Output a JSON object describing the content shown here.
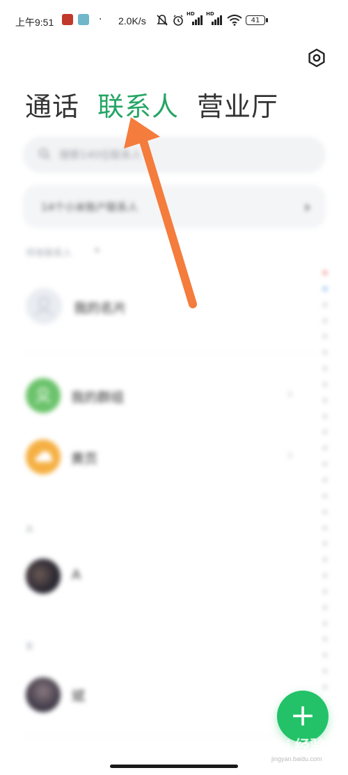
{
  "status_bar": {
    "time": "上午9:51",
    "network_speed": "2.0K/s",
    "hd_label_1": "HD",
    "hd_label_2": "HD",
    "battery": "41"
  },
  "tabs": [
    {
      "label": "通话",
      "active": false
    },
    {
      "label": "联系人",
      "active": true
    },
    {
      "label": "营业厅",
      "active": false
    }
  ],
  "search": {
    "placeholder": "搜索140位联系人"
  },
  "account_banner": {
    "text": "14个小米账户联系人"
  },
  "all_contacts_label": "所有联系人",
  "my_card": "我的名片",
  "groups": [
    {
      "label": "我的群组",
      "icon": "group-icon",
      "color": "#6cc36c"
    },
    {
      "label": "黄页",
      "icon": "cloud-icon",
      "color": "#f5b043"
    }
  ],
  "sections": [
    {
      "letter": "A",
      "contact": "A"
    },
    {
      "letter": "B",
      "contact": "斌"
    }
  ],
  "fab_label": "+",
  "colors": {
    "accent": "#25a565",
    "fab": "#23c268",
    "arrow": "#f47c3c"
  },
  "watermark": {
    "text": "Bai 经验",
    "sub": "jingyan.baidu.com"
  }
}
